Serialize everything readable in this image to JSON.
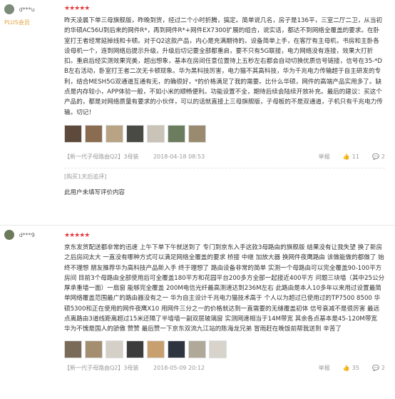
{
  "reviews": [
    {
      "user": {
        "name": "d***u",
        "badge": "PLUS会员",
        "avatar_color": "#7c8b7a"
      },
      "stars": "★★★★★",
      "text": "昨天凌晨下单三母旗舰版，昨晚到货，经过二个小时折腾，搞定。简单说几名，房子是136平，三室二厅二卫，从当初的华硕AC56U到后来的网件R*，再到网件R*+网件EX7300扩展的组合，说实话，都达不到网络全覆盖的要求。在卧室打王者经常延掉线和卡顿。对于Q2这款产品，内心是充满期待的。设备简单上手，在客厅有主母机，书房和主卧各设母机一个，连到网络后提示升级，升级后切记要全部都重启，要不只有5G联接，电力网络没有连接，效果大打折扣。重启后经实测效果完美，超出想象，基本在房间任意位置待上五秒左右都会自动切换优质信号链接，信号在35-*DB左右活动，卧室打王者二次无卡顿现象。华为黑科技厉害，电力猫不其高科技，华为千兆电力传输超于自主研发的专利，结合MESH5G双通道互通有无，的确很好，*的价格满足了我的需要。比什么华硕，网件的高端产品实用多了。缺点是内存较小，APP体验一般，不如小米的顺畅便利。功能设置不全，期待后续会陆续开放补充。最后的建议：买这个产品的，都是对网络质量有要求的小伙伴，可以的话就直接上三母旗舰版，子母板的不是双通道，子机只有千兆电力传输。切记！",
      "thumbs": [
        "#5e4a3c",
        "#8a6d50",
        "#b9a385",
        "#4a4a45",
        "#c9c3b8",
        "#6b7d5e",
        "#9a8a70"
      ],
      "product": "【新一代子母路由Q2】3母装",
      "date": "2018-04-18 08:53",
      "report": "举报",
      "likes": "11",
      "comments": "2",
      "append_label": "[购买1天后追评]",
      "append_text": "此用户未填写评价内容"
    },
    {
      "user": {
        "name": "d***9",
        "badge": "",
        "avatar_color": "#6a7a5a"
      },
      "stars": "★★★★★",
      "text": "京东发货配送都非常的迅速 上午下单下午就送到了 专门到京东入手这款3母路由的旗舰版 结果没有让我失望 换了新房之后房间太大 一直没有哪种方式可以满足网络全覆盖的要求 桥接 中继 加放大器 换网件夜鹰路由 该做能做的都做了 始终不理想 朋友推荐华为高科技产品新入手 终于理想了 路由设备非常的简单 实测一个母路由可以完全覆盖90-100平方房间 目前3个母路由全部使用后可全覆盖180平方和花园平台200多方全部一起接近400平方 问题三块墙（其中25公分厚承重墙一面）一扇窗 能够完全覆盖 200M电信光纤最高测速达到236M左右 此路由是本人10多年以来用过设置最简单网络覆盖范围最广的路由器没有之一 华为自主设计千兆电力猫技术高于 个人以为超过已使用过的TP7500 8500 华硕5300和正在使用的网件夜鹰X10 用网件三分之一的价格就达到一直需要的无缝覆盖初体 信号衰减不是很厉害 最远点离路由3道线距离超过15米还隔了半墙墙一副双层玻璃窗 实测网速相当于14M带宽 其余各点基本是45-120M带宽 华为不愧是国人的骄傲 赞赞 最后赞一下京东双流九江站的陈海龙兄弟 冒雨赶在晚饭前帮我送到 辛苦了",
      "thumbs": [
        "#7a6a58",
        "#a48e70",
        "#d4d0c8",
        "#3c3c3c",
        "#c8a070",
        "#2e3440",
        "#b0a898",
        "#d8d4cc"
      ],
      "product": "【新一代子母路由Q2】3母装",
      "date": "2018-05-09 20:12",
      "report": "举报",
      "likes": "35",
      "comments": "2"
    }
  ]
}
